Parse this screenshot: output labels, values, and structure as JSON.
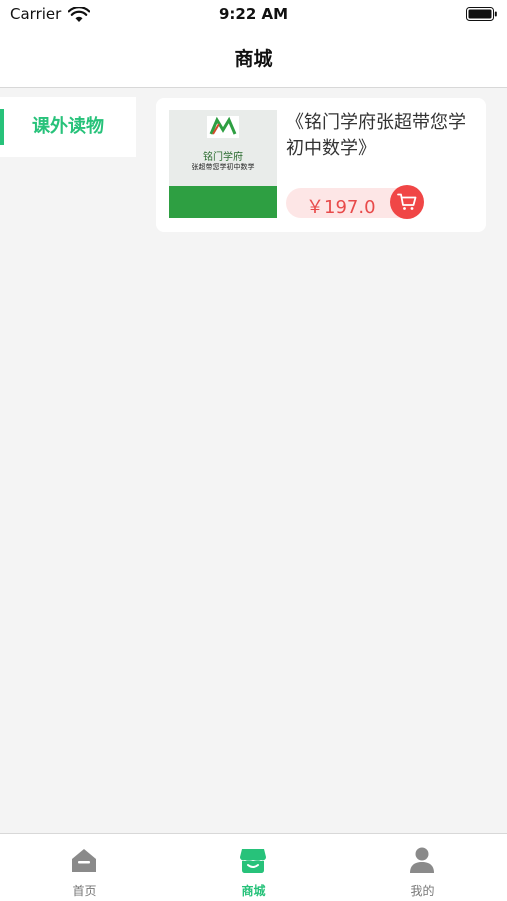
{
  "status_bar": {
    "carrier": "Carrier",
    "time": "9:22 AM"
  },
  "nav": {
    "title": "商城"
  },
  "sidebar": {
    "categories": [
      {
        "label": "课外读物",
        "selected": true
      }
    ]
  },
  "products": [
    {
      "title": "《铭门学府张超带您学初中数学》",
      "price": "￥197.0",
      "cover_text": [
        "铭门学府",
        "张超带您学初中数学"
      ]
    }
  ],
  "tabbar": {
    "items": [
      {
        "label": "首页",
        "icon": "home-icon"
      },
      {
        "label": "商城",
        "icon": "shop-icon"
      },
      {
        "label": "我的",
        "icon": "user-icon"
      }
    ],
    "active_index": 1
  },
  "colors": {
    "accent": "#27c27a",
    "price": "#e84a4a",
    "cart": "#f04646",
    "price_bg": "#fde6e6"
  }
}
